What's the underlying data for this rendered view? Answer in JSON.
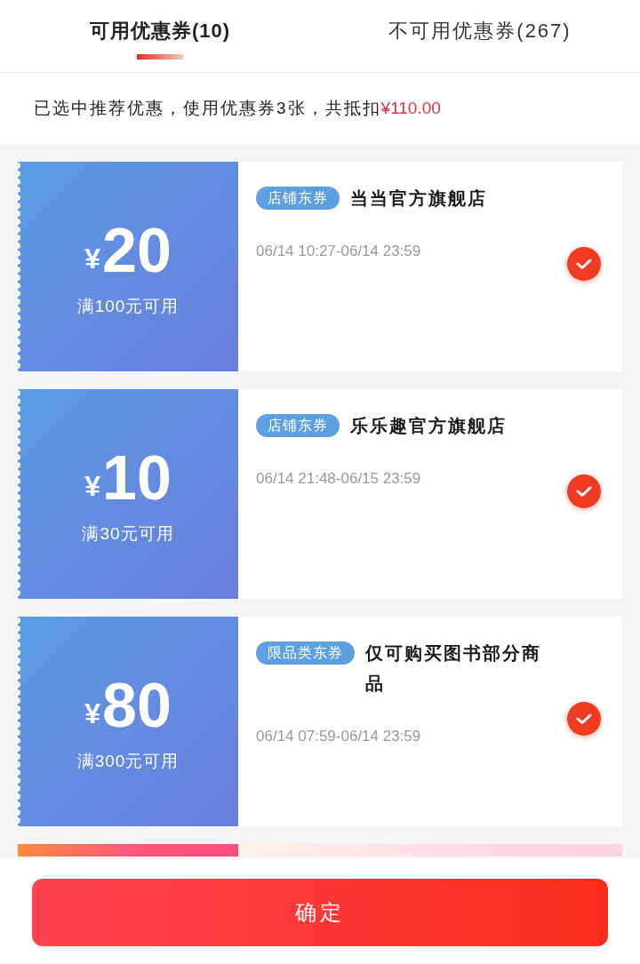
{
  "tabs": [
    {
      "label": "可用优惠券(10)",
      "selected": true
    },
    {
      "label": "不可用优惠券(267)",
      "selected": false
    }
  ],
  "summary": {
    "text": "已选中推荐优惠，使用优惠券3张，共抵扣",
    "amount": "¥110.00"
  },
  "coupons": [
    {
      "kind": "full",
      "currency": "¥",
      "amount": "20",
      "condition": "满100元可用",
      "badge": "店铺东券",
      "title": "当当官方旗舰店",
      "period": "06/14 10:27-06/14 23:59",
      "checked": true
    },
    {
      "kind": "full",
      "currency": "¥",
      "amount": "10",
      "condition": "满30元可用",
      "badge": "店铺东券",
      "title": "乐乐趣官方旗舰店",
      "period": "06/14 21:48-06/15 23:59",
      "checked": true
    },
    {
      "kind": "full",
      "currency": "¥",
      "amount": "80",
      "condition": "满300元可用",
      "badge": "限品类东券",
      "title": "仅可购买图书部分商品",
      "period": "06/14 07:59-06/14 23:59",
      "checked": true
    },
    {
      "kind": "cut"
    }
  ],
  "confirm_button": "确定"
}
